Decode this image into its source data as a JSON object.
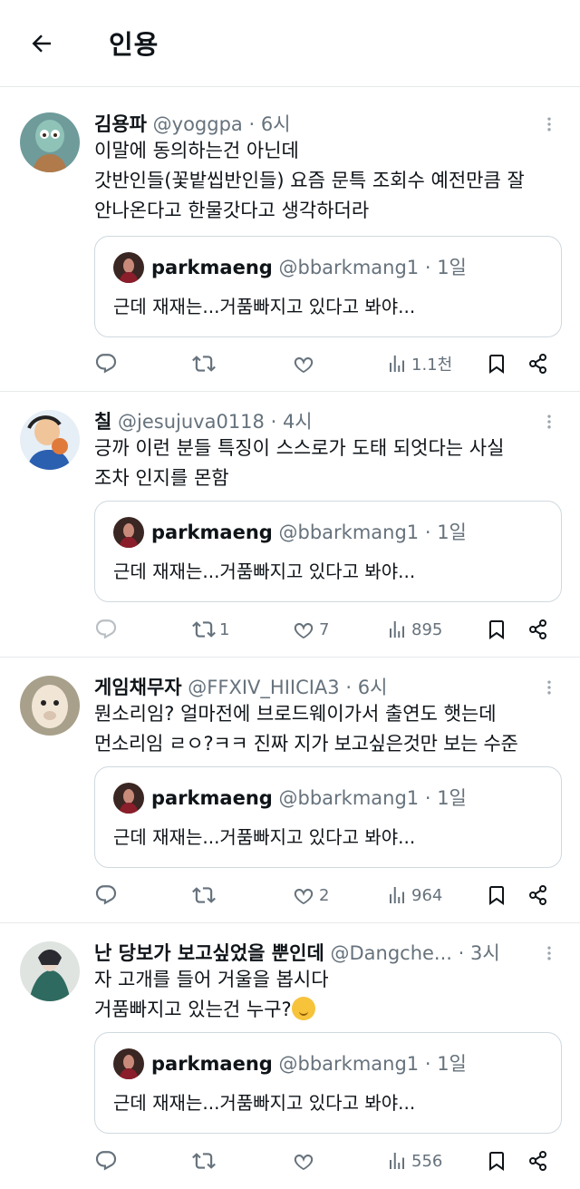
{
  "header": {
    "title": "인용"
  },
  "quoted": {
    "name": "parkmaeng",
    "handle": "@bbarkmang1",
    "sep": " · ",
    "age": "1일",
    "text": "근데 재재는...거품빠지고 있다고 봐야..."
  },
  "tweets": [
    {
      "name": "김용파",
      "handle": "@yoggpa",
      "sep": " · ",
      "age": "6시",
      "lines": [
        "이말에 동의하는건 아닌데",
        "갓반인들(꽃밭씹반인들) 요즘 문특 조회수 예전만큼 잘",
        "안나온다고 한물갓다고 생각하더라"
      ],
      "retweets": "",
      "likes": "",
      "views": "1.1천",
      "avatar_color": "#5c8a8a"
    },
    {
      "name": "칠",
      "handle": "@jesujuva0118",
      "sep": " · ",
      "age": "4시",
      "lines": [
        "긍까 이런 분들 특징이 스스로가 도태 되엇다는 사실",
        "조차 인지를 몬함"
      ],
      "retweets": "1",
      "likes": "7",
      "views": "895",
      "avatar_color": "#e8a070"
    },
    {
      "name": "게임채무자",
      "handle": "@FFXIV_HIICIA3",
      "sep": " · ",
      "age": "6시",
      "lines": [
        "뭔소리임? 얼마전에 브로드웨이가서 출연도 햇는데",
        "먼소리임 ㄹㅇ?ㅋㅋ 진짜 지가 보고싶은것만 보는 수준"
      ],
      "retweets": "",
      "likes": "2",
      "views": "964",
      "avatar_color": "#c9b49a"
    },
    {
      "name": "난 당보가 보고싶었을 뿐인데",
      "handle": "@Dangche...",
      "sep": " · ",
      "age": "3시",
      "lines": [
        "자 고개를 들어 거울을 봅시다",
        "거품빠지고 있는건 누구?"
      ],
      "emoji": "shushing-face-emoji",
      "retweets": "",
      "likes": "",
      "views": "556",
      "avatar_color": "#3d5a58"
    }
  ],
  "colors": {
    "text": "#0f1419",
    "secondary": "#66727c",
    "border": "#cfd9de",
    "divider": "#e6e9eb"
  }
}
